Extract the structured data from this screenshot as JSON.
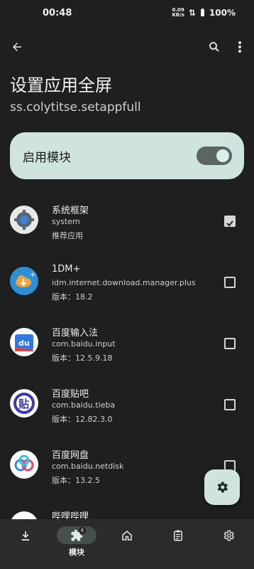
{
  "status": {
    "time": "00:48",
    "net_speed_value": "0.09",
    "net_speed_unit": "KB/s",
    "battery": "100%"
  },
  "header": {
    "title": "设置应用全屏",
    "package": "ss.colytitse.setappfull"
  },
  "enable": {
    "label": "启用模块",
    "on": true
  },
  "apps": [
    {
      "name": "系统框架",
      "package": "system",
      "extra": "推荐应用",
      "checked": true,
      "icon": "android-system-icon"
    },
    {
      "name": "1DM+",
      "package": "idm.internet.download.manager.plus",
      "extra": "版本：18.2",
      "checked": false,
      "icon": "cloud-download-icon"
    },
    {
      "name": "百度输入法",
      "package": "com.baidu.input",
      "extra": "版本：12.5.9.18",
      "checked": false,
      "icon": "du-keyboard-icon"
    },
    {
      "name": "百度贴吧",
      "package": "com.baidu.tieba",
      "extra": "版本：12.82.3.0",
      "checked": false,
      "icon": "tieba-icon"
    },
    {
      "name": "百度网盘",
      "package": "com.baidu.netdisk",
      "extra": "版本：13.2.5",
      "checked": false,
      "icon": "netdisk-icon"
    },
    {
      "name": "哔哩哔哩",
      "package": "",
      "extra": "",
      "checked": false,
      "icon": "bilibili-icon"
    }
  ],
  "nav": {
    "active_label": "模块",
    "badge": "6"
  },
  "colors": {
    "background": "#1f1f1f",
    "card": "#cfe3df",
    "nav": "#2b2b2b",
    "pill": "#45504e"
  }
}
